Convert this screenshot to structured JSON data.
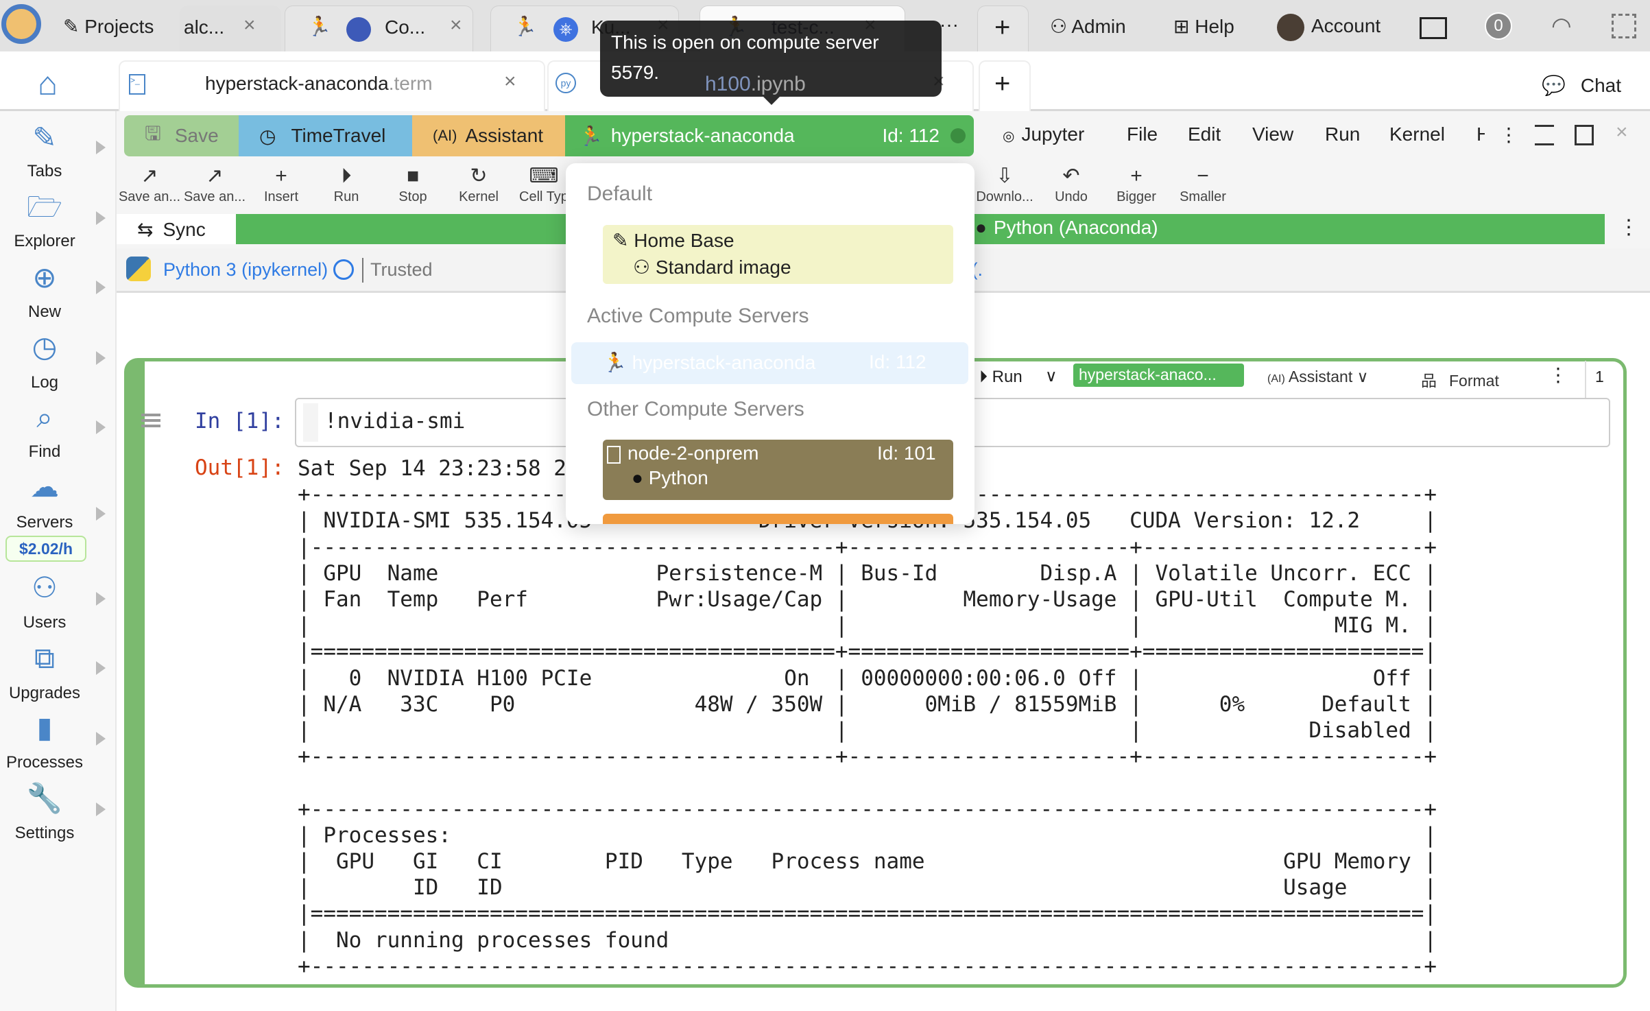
{
  "topbar": {
    "projects_label": "Projects",
    "tabs": [
      {
        "label": "alc...",
        "close": "×"
      },
      {
        "label": "Co...",
        "close": "×"
      },
      {
        "label": "Ku...",
        "close": "×"
      },
      {
        "label": "test-c...",
        "close": "×"
      }
    ],
    "more": "···",
    "add": "+",
    "admin": "Admin",
    "help": "Help",
    "account": "Account",
    "notifications_count": "0"
  },
  "tooltip": {
    "text": "This is open on compute server 5579."
  },
  "file_tabs": [
    {
      "name": "hyperstack-anaconda",
      "ext": ".term",
      "close": "×"
    },
    {
      "name": "h100",
      "ext": ".ipynb",
      "close": "×"
    }
  ],
  "file_tabs_add": "+",
  "chat_label": "Chat",
  "sidebar": {
    "items": [
      {
        "label": "Tabs",
        "icon": "pencil-icon"
      },
      {
        "label": "Explorer",
        "icon": "folder-open-icon"
      },
      {
        "label": "New",
        "icon": "plus-circle-icon"
      },
      {
        "label": "Log",
        "icon": "history-icon"
      },
      {
        "label": "Find",
        "icon": "search-icon"
      },
      {
        "label": "Servers",
        "icon": "cloud-server-icon"
      },
      {
        "label": "Users",
        "icon": "users-icon"
      },
      {
        "label": "Upgrades",
        "icon": "sliders-icon"
      },
      {
        "label": "Processes",
        "icon": "chip-icon"
      },
      {
        "label": "Settings",
        "icon": "wrench-icon"
      }
    ],
    "cost_badge": "$2.02/h"
  },
  "editor_toolbar": {
    "save": "Save",
    "timetravel": "TimeTravel",
    "assistant": "Assistant",
    "server_name": "hyperstack-anaconda",
    "server_id": "Id: 112",
    "colors": {
      "save": "#a3cf94",
      "timetravel": "#78bde0",
      "assistant": "#efc072",
      "server": "#55b75b"
    }
  },
  "menus": {
    "jupyter": "Jupyter",
    "file": "File",
    "edit": "Edit",
    "view": "View",
    "run": "Run",
    "kernel": "Kernel",
    "help_partial": "H"
  },
  "buttons": [
    "Save an...",
    "Save an...",
    "Insert",
    "Run",
    "Stop",
    "Kernel",
    "Cell Typ",
    "Downlo...",
    "Undo",
    "Bigger",
    "Smaller"
  ],
  "sync_label": "Sync",
  "env_label": "Python (Anaconda)",
  "kernel_status": {
    "kernel": "Python 3 (ipykernel)",
    "trusted": "Trusted",
    "partial": ".)"
  },
  "dropdown": {
    "default_header": "Default",
    "home_base": "Home Base",
    "standard_image": "Standard image",
    "active_header": "Active Compute Servers",
    "active": {
      "name": "hyperstack-anaconda",
      "id": "Id: 112"
    },
    "other_header": "Other Compute Servers",
    "other": {
      "name": "node-2-onprem",
      "id": "Id: 101",
      "image": "Python"
    },
    "colors": {
      "home": "#f3f4c9",
      "active": "#e8f3fd",
      "other": "#8a7d56",
      "next": "#f09a3e"
    }
  },
  "cell": {
    "run": "Run",
    "server_pill": "hyperstack-anaco...",
    "assistant": "Assistant",
    "format": "Format",
    "count": "1",
    "in_prompt": "In [1]:",
    "out_prompt": "Out[1]:",
    "code": "!nvidia-smi",
    "output": "Sat Sep 14 23:23:58 2024\n+---------------------------------------------------------------------------------------+\n| NVIDIA-SMI 535.154.05             Driver Version: 535.154.05   CUDA Version: 12.2     |\n|-----------------------------------------+----------------------+----------------------+\n| GPU  Name                 Persistence-M | Bus-Id        Disp.A | Volatile Uncorr. ECC |\n| Fan  Temp   Perf          Pwr:Usage/Cap |         Memory-Usage | GPU-Util  Compute M. |\n|                                         |                      |               MIG M. |\n|=========================================+======================+======================|\n|   0  NVIDIA H100 PCIe               On  | 00000000:00:06.0 Off |                  Off |\n| N/A   33C    P0              48W / 350W |      0MiB / 81559MiB |      0%      Default |\n|                                         |                      |             Disabled |\n+-----------------------------------------+----------------------+----------------------+\n\n+---------------------------------------------------------------------------------------+\n| Processes:                                                                            |\n|  GPU   GI   CI        PID   Type   Process name                            GPU Memory |\n|        ID   ID                                                             Usage      |\n|=======================================================================================|\n|  No running processes found                                                           |\n+---------------------------------------------------------------------------------------+"
  }
}
